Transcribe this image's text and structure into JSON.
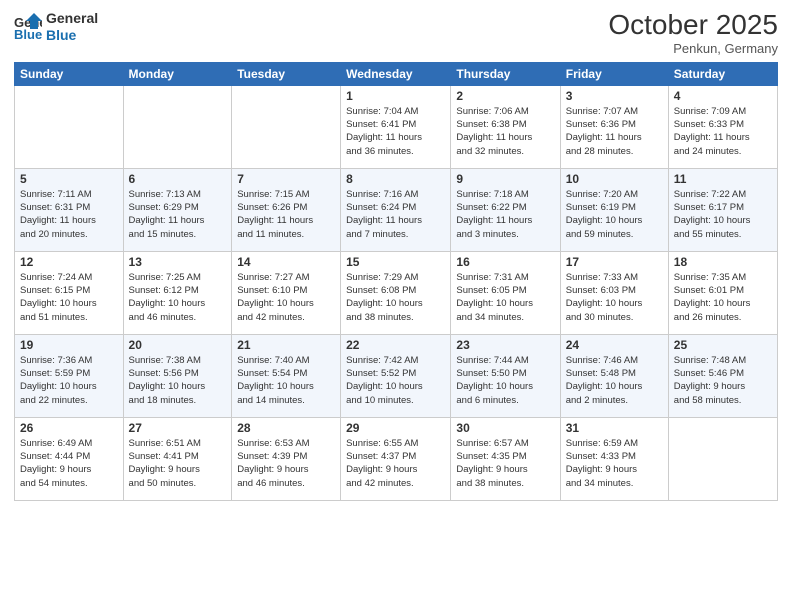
{
  "header": {
    "logo_line1": "General",
    "logo_line2": "Blue",
    "month": "October 2025",
    "location": "Penkun, Germany"
  },
  "days_of_week": [
    "Sunday",
    "Monday",
    "Tuesday",
    "Wednesday",
    "Thursday",
    "Friday",
    "Saturday"
  ],
  "weeks": [
    [
      {
        "num": "",
        "info": ""
      },
      {
        "num": "",
        "info": ""
      },
      {
        "num": "",
        "info": ""
      },
      {
        "num": "1",
        "info": "Sunrise: 7:04 AM\nSunset: 6:41 PM\nDaylight: 11 hours\nand 36 minutes."
      },
      {
        "num": "2",
        "info": "Sunrise: 7:06 AM\nSunset: 6:38 PM\nDaylight: 11 hours\nand 32 minutes."
      },
      {
        "num": "3",
        "info": "Sunrise: 7:07 AM\nSunset: 6:36 PM\nDaylight: 11 hours\nand 28 minutes."
      },
      {
        "num": "4",
        "info": "Sunrise: 7:09 AM\nSunset: 6:33 PM\nDaylight: 11 hours\nand 24 minutes."
      }
    ],
    [
      {
        "num": "5",
        "info": "Sunrise: 7:11 AM\nSunset: 6:31 PM\nDaylight: 11 hours\nand 20 minutes."
      },
      {
        "num": "6",
        "info": "Sunrise: 7:13 AM\nSunset: 6:29 PM\nDaylight: 11 hours\nand 15 minutes."
      },
      {
        "num": "7",
        "info": "Sunrise: 7:15 AM\nSunset: 6:26 PM\nDaylight: 11 hours\nand 11 minutes."
      },
      {
        "num": "8",
        "info": "Sunrise: 7:16 AM\nSunset: 6:24 PM\nDaylight: 11 hours\nand 7 minutes."
      },
      {
        "num": "9",
        "info": "Sunrise: 7:18 AM\nSunset: 6:22 PM\nDaylight: 11 hours\nand 3 minutes."
      },
      {
        "num": "10",
        "info": "Sunrise: 7:20 AM\nSunset: 6:19 PM\nDaylight: 10 hours\nand 59 minutes."
      },
      {
        "num": "11",
        "info": "Sunrise: 7:22 AM\nSunset: 6:17 PM\nDaylight: 10 hours\nand 55 minutes."
      }
    ],
    [
      {
        "num": "12",
        "info": "Sunrise: 7:24 AM\nSunset: 6:15 PM\nDaylight: 10 hours\nand 51 minutes."
      },
      {
        "num": "13",
        "info": "Sunrise: 7:25 AM\nSunset: 6:12 PM\nDaylight: 10 hours\nand 46 minutes."
      },
      {
        "num": "14",
        "info": "Sunrise: 7:27 AM\nSunset: 6:10 PM\nDaylight: 10 hours\nand 42 minutes."
      },
      {
        "num": "15",
        "info": "Sunrise: 7:29 AM\nSunset: 6:08 PM\nDaylight: 10 hours\nand 38 minutes."
      },
      {
        "num": "16",
        "info": "Sunrise: 7:31 AM\nSunset: 6:05 PM\nDaylight: 10 hours\nand 34 minutes."
      },
      {
        "num": "17",
        "info": "Sunrise: 7:33 AM\nSunset: 6:03 PM\nDaylight: 10 hours\nand 30 minutes."
      },
      {
        "num": "18",
        "info": "Sunrise: 7:35 AM\nSunset: 6:01 PM\nDaylight: 10 hours\nand 26 minutes."
      }
    ],
    [
      {
        "num": "19",
        "info": "Sunrise: 7:36 AM\nSunset: 5:59 PM\nDaylight: 10 hours\nand 22 minutes."
      },
      {
        "num": "20",
        "info": "Sunrise: 7:38 AM\nSunset: 5:56 PM\nDaylight: 10 hours\nand 18 minutes."
      },
      {
        "num": "21",
        "info": "Sunrise: 7:40 AM\nSunset: 5:54 PM\nDaylight: 10 hours\nand 14 minutes."
      },
      {
        "num": "22",
        "info": "Sunrise: 7:42 AM\nSunset: 5:52 PM\nDaylight: 10 hours\nand 10 minutes."
      },
      {
        "num": "23",
        "info": "Sunrise: 7:44 AM\nSunset: 5:50 PM\nDaylight: 10 hours\nand 6 minutes."
      },
      {
        "num": "24",
        "info": "Sunrise: 7:46 AM\nSunset: 5:48 PM\nDaylight: 10 hours\nand 2 minutes."
      },
      {
        "num": "25",
        "info": "Sunrise: 7:48 AM\nSunset: 5:46 PM\nDaylight: 9 hours\nand 58 minutes."
      }
    ],
    [
      {
        "num": "26",
        "info": "Sunrise: 6:49 AM\nSunset: 4:44 PM\nDaylight: 9 hours\nand 54 minutes."
      },
      {
        "num": "27",
        "info": "Sunrise: 6:51 AM\nSunset: 4:41 PM\nDaylight: 9 hours\nand 50 minutes."
      },
      {
        "num": "28",
        "info": "Sunrise: 6:53 AM\nSunset: 4:39 PM\nDaylight: 9 hours\nand 46 minutes."
      },
      {
        "num": "29",
        "info": "Sunrise: 6:55 AM\nSunset: 4:37 PM\nDaylight: 9 hours\nand 42 minutes."
      },
      {
        "num": "30",
        "info": "Sunrise: 6:57 AM\nSunset: 4:35 PM\nDaylight: 9 hours\nand 38 minutes."
      },
      {
        "num": "31",
        "info": "Sunrise: 6:59 AM\nSunset: 4:33 PM\nDaylight: 9 hours\nand 34 minutes."
      },
      {
        "num": "",
        "info": ""
      }
    ]
  ]
}
